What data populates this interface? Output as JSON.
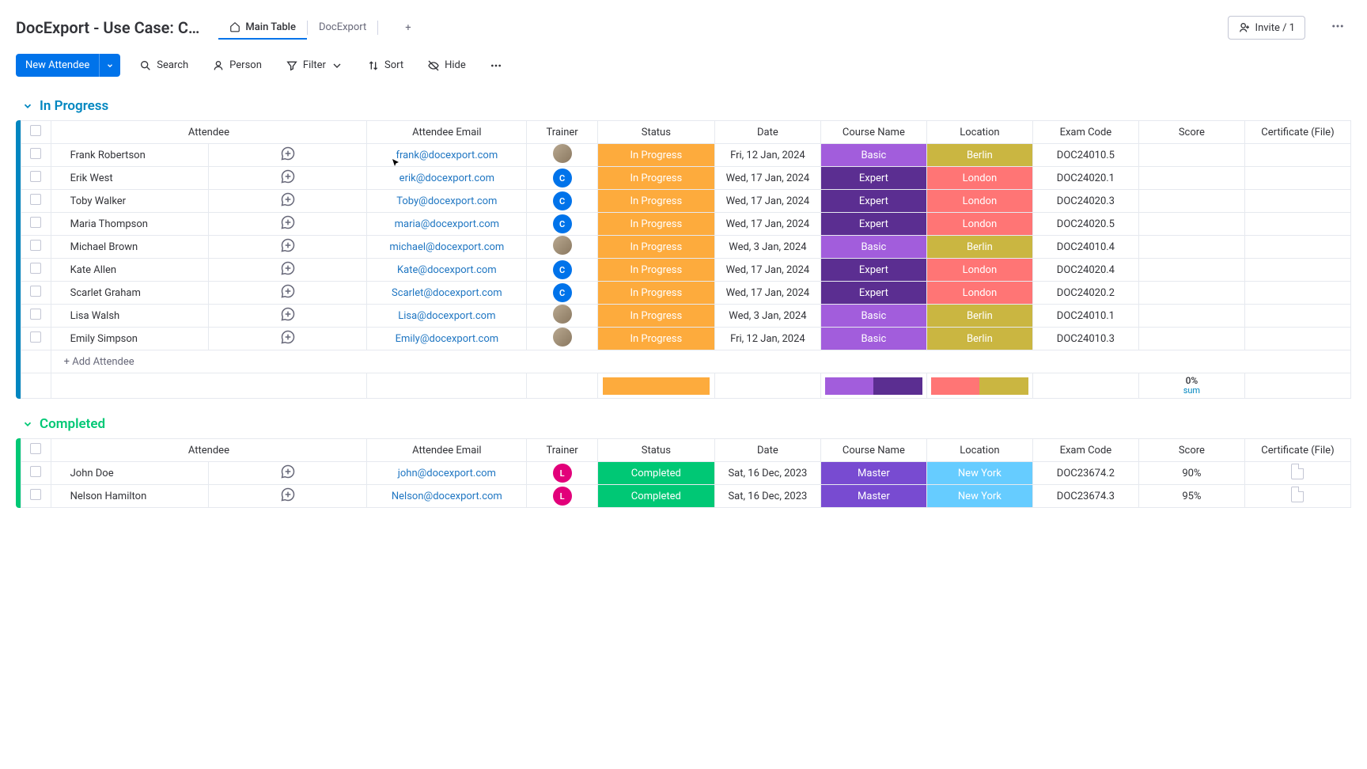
{
  "header": {
    "title": "DocExport - Use Case: C…",
    "tabs": [
      {
        "label": "Main Table",
        "active": true
      },
      {
        "label": "DocExport",
        "active": false
      }
    ],
    "invite": "Invite / 1"
  },
  "toolbar": {
    "new_label": "New Attendee",
    "search": "Search",
    "person": "Person",
    "filter": "Filter",
    "sort": "Sort",
    "hide": "Hide"
  },
  "columns": [
    "Attendee",
    "Attendee Email",
    "Trainer",
    "Status",
    "Date",
    "Course Name",
    "Location",
    "Exam Code",
    "Score",
    "Certificate (File)"
  ],
  "groups": [
    {
      "name": "In Progress",
      "accent": "inprog",
      "rows": [
        {
          "attendee": "Frank Robertson",
          "email": "frank@docexport.com",
          "trainer": "img",
          "status": "In Progress",
          "status_color": "#fdab3d",
          "date": "Fri, 12 Jan, 2024",
          "course": "Basic",
          "course_color": "#a25ddc",
          "location": "Berlin",
          "loc_color": "#cab641",
          "code": "DOC24010.5",
          "score": "",
          "cert": false
        },
        {
          "attendee": "Erik West",
          "email": "erik@docexport.com",
          "trainer": "c",
          "status": "In Progress",
          "status_color": "#fdab3d",
          "date": "Wed, 17 Jan, 2024",
          "course": "Expert",
          "course_color": "#5b2e91",
          "location": "London",
          "loc_color": "#ff7575",
          "code": "DOC24020.1",
          "score": "",
          "cert": false
        },
        {
          "attendee": "Toby Walker",
          "email": "Toby@docexport.com",
          "trainer": "c",
          "status": "In Progress",
          "status_color": "#fdab3d",
          "date": "Wed, 17 Jan, 2024",
          "course": "Expert",
          "course_color": "#5b2e91",
          "location": "London",
          "loc_color": "#ff7575",
          "code": "DOC24020.3",
          "score": "",
          "cert": false
        },
        {
          "attendee": "Maria Thompson",
          "email": "maria@docexport.com",
          "trainer": "c",
          "status": "In Progress",
          "status_color": "#fdab3d",
          "date": "Wed, 17 Jan, 2024",
          "course": "Expert",
          "course_color": "#5b2e91",
          "location": "London",
          "loc_color": "#ff7575",
          "code": "DOC24020.5",
          "score": "",
          "cert": false
        },
        {
          "attendee": "Michael Brown",
          "email": "michael@docexport.com",
          "trainer": "img",
          "status": "In Progress",
          "status_color": "#fdab3d",
          "date": "Wed, 3 Jan, 2024",
          "course": "Basic",
          "course_color": "#a25ddc",
          "location": "Berlin",
          "loc_color": "#cab641",
          "code": "DOC24010.4",
          "score": "",
          "cert": false
        },
        {
          "attendee": "Kate Allen",
          "email": "Kate@docexport.com",
          "trainer": "c",
          "status": "In Progress",
          "status_color": "#fdab3d",
          "date": "Wed, 17 Jan, 2024",
          "course": "Expert",
          "course_color": "#5b2e91",
          "location": "London",
          "loc_color": "#ff7575",
          "code": "DOC24020.4",
          "score": "",
          "cert": false
        },
        {
          "attendee": "Scarlet Graham",
          "email": "Scarlet@docexport.com",
          "trainer": "c",
          "status": "In Progress",
          "status_color": "#fdab3d",
          "date": "Wed, 17 Jan, 2024",
          "course": "Expert",
          "course_color": "#5b2e91",
          "location": "London",
          "loc_color": "#ff7575",
          "code": "DOC24020.2",
          "score": "",
          "cert": false
        },
        {
          "attendee": "Lisa Walsh",
          "email": "Lisa@docexport.com",
          "trainer": "img",
          "status": "In Progress",
          "status_color": "#fdab3d",
          "date": "Wed, 3 Jan, 2024",
          "course": "Basic",
          "course_color": "#a25ddc",
          "location": "Berlin",
          "loc_color": "#cab641",
          "code": "DOC24010.1",
          "score": "",
          "cert": false
        },
        {
          "attendee": "Emily Simpson",
          "email": "Emily@docexport.com",
          "trainer": "img",
          "status": "In Progress",
          "status_color": "#fdab3d",
          "date": "Fri, 12 Jan, 2024",
          "course": "Basic",
          "course_color": "#a25ddc",
          "location": "Berlin",
          "loc_color": "#cab641",
          "code": "DOC24010.3",
          "score": "",
          "cert": false
        }
      ],
      "add_label": "+ Add Attendee",
      "summary": {
        "status": "#fdab3d",
        "course": [
          "#a25ddc",
          "#5b2e91"
        ],
        "location": [
          "#ff7575",
          "#cab641"
        ],
        "score_pct": "0%",
        "score_lbl": "sum"
      }
    },
    {
      "name": "Completed",
      "accent": "completed",
      "rows": [
        {
          "attendee": "John Doe",
          "email": "john@docexport.com",
          "trainer": "l",
          "status": "Completed",
          "status_color": "#00c875",
          "date": "Sat, 16 Dec, 2023",
          "course": "Master",
          "course_color": "#784bd1",
          "location": "New York",
          "loc_color": "#66ccff",
          "code": "DOC23674.2",
          "score": "90%",
          "cert": true
        },
        {
          "attendee": "Nelson Hamilton",
          "email": "Nelson@docexport.com",
          "trainer": "l",
          "status": "Completed",
          "status_color": "#00c875",
          "date": "Sat, 16 Dec, 2023",
          "course": "Master",
          "course_color": "#784bd1",
          "location": "New York",
          "loc_color": "#66ccff",
          "code": "DOC23674.3",
          "score": "95%",
          "cert": true
        }
      ]
    }
  ]
}
